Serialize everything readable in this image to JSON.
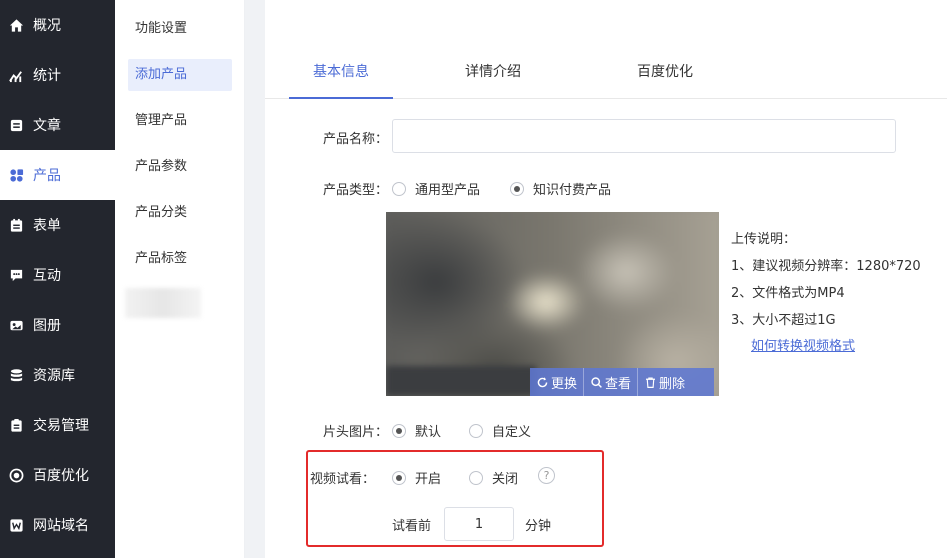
{
  "sidebar": {
    "items": [
      {
        "label": "概况",
        "icon": "home-icon"
      },
      {
        "label": "统计",
        "icon": "chart-icon"
      },
      {
        "label": "文章",
        "icon": "article-icon"
      },
      {
        "label": "产品",
        "icon": "grid-icon"
      },
      {
        "label": "表单",
        "icon": "form-icon"
      },
      {
        "label": "互动",
        "icon": "chat-icon"
      },
      {
        "label": "图册",
        "icon": "album-icon"
      },
      {
        "label": "资源库",
        "icon": "database-icon"
      },
      {
        "label": "交易管理",
        "icon": "clipboard-icon"
      },
      {
        "label": "百度优化",
        "icon": "target-icon"
      },
      {
        "label": "网站域名",
        "icon": "w-icon"
      }
    ],
    "active_index": 3,
    "bg_color": "#23262e",
    "accent_color": "#4b6bd6"
  },
  "submenu": {
    "items": [
      "功能设置",
      "添加产品",
      "管理产品",
      "产品参数",
      "产品分类",
      "产品标签"
    ],
    "active_index": 1
  },
  "tabs": [
    {
      "label": "基本信息",
      "active": true
    },
    {
      "label": "详情介绍",
      "active": false
    },
    {
      "label": "百度优化",
      "active": false
    }
  ],
  "form": {
    "product_name_label": "产品名称：",
    "product_name_value": "",
    "product_type_label": "产品类型：",
    "product_type_options": [
      {
        "label": "通用型产品",
        "checked": false
      },
      {
        "label": "知识付费产品",
        "checked": true
      }
    ],
    "video_actions": [
      {
        "label": "更换",
        "icon": "refresh-icon"
      },
      {
        "label": "查看",
        "icon": "search-icon"
      },
      {
        "label": "删除",
        "icon": "trash-icon"
      }
    ],
    "upload_notes": {
      "title": "上传说明：",
      "lines": [
        "1、建议视频分辨率：1280*720",
        "2、文件格式为MP4",
        "3、大小不超过1G"
      ],
      "link": "如何转换视频格式"
    },
    "cover_label": "片头图片：",
    "cover_options": [
      {
        "label": "默认",
        "checked": true
      },
      {
        "label": "自定义",
        "checked": false
      }
    ],
    "trial_label": "视频试看：",
    "trial_options": [
      {
        "label": "开启",
        "checked": true
      },
      {
        "label": "关闭",
        "checked": false
      }
    ],
    "help_symbol": "?",
    "trial_before_label": "试看前",
    "trial_minutes": "1",
    "trial_unit": "分钟",
    "highlight_color": "#e32b2b"
  }
}
